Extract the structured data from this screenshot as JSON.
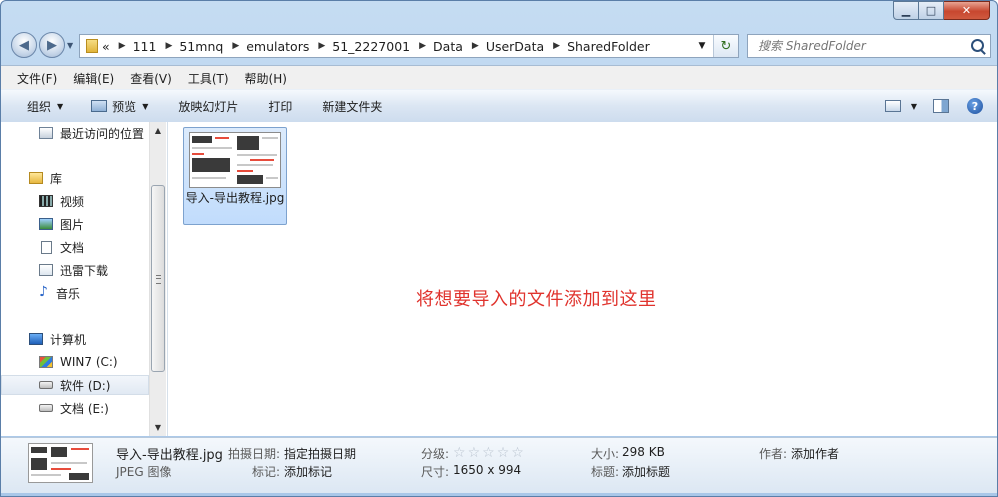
{
  "window": {
    "caption": {
      "minimize": "▁",
      "maximize": "□",
      "close": "✕"
    }
  },
  "nav": {
    "back_icon": "back-arrow-icon",
    "forward_icon": "forward-arrow-icon",
    "address": {
      "overflow": "«",
      "crumbs": [
        "111",
        "51mnq",
        "emulators",
        "51_2227001",
        "Data",
        "UserData",
        "SharedFolder"
      ]
    },
    "search": {
      "placeholder": "搜索 SharedFolder"
    }
  },
  "menu": {
    "items": [
      "文件(F)",
      "编辑(E)",
      "查看(V)",
      "工具(T)",
      "帮助(H)"
    ]
  },
  "toolbar": {
    "organize": "组织",
    "preview": "预览",
    "slideshow": "放映幻灯片",
    "print": "打印",
    "new_folder": "新建文件夹"
  },
  "sidebar": {
    "items": [
      {
        "label": "最近访问的位置",
        "icon": "recent-places-icon"
      },
      {
        "label": "库",
        "icon": "library-icon"
      },
      {
        "label": "视频",
        "icon": "video-icon"
      },
      {
        "label": "图片",
        "icon": "pictures-icon"
      },
      {
        "label": "文档",
        "icon": "documents-icon"
      },
      {
        "label": "迅雷下载",
        "icon": "thunder-download-icon"
      },
      {
        "label": "音乐",
        "icon": "music-icon"
      },
      {
        "label": "计算机",
        "icon": "computer-icon"
      },
      {
        "label": "WIN7 (C:)",
        "icon": "system-drive-icon"
      },
      {
        "label": "软件 (D:)",
        "icon": "drive-icon",
        "selected": true
      },
      {
        "label": "文档 (E:)",
        "icon": "drive-icon"
      }
    ]
  },
  "content": {
    "files": [
      {
        "name": "导入-导出教程.jpg"
      }
    ],
    "drop_hint": "将想要导入的文件添加到这里"
  },
  "details": {
    "file_name": "导入-导出教程.jpg",
    "file_type": "JPEG 图像",
    "date_taken_label": "拍摄日期:",
    "date_taken_value": "指定拍摄日期",
    "tags_label": "标记:",
    "tags_value": "添加标记",
    "rating_label": "分级:",
    "rating_stars": 0,
    "dimensions_label": "尺寸:",
    "dimensions_value": "1650 x 994",
    "size_label": "大小:",
    "size_value": "298 KB",
    "title_label": "标题:",
    "title_value": "添加标题",
    "author_label": "作者:",
    "author_value": "添加作者"
  },
  "colors": {
    "accent": "#e0332d",
    "selection": "#c1dcfc"
  }
}
